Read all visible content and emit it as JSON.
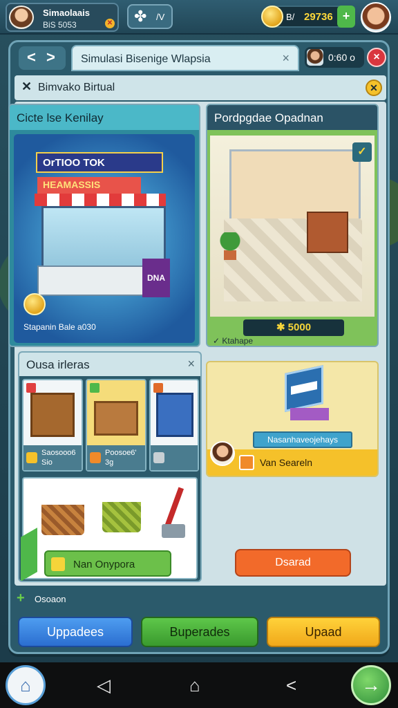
{
  "player": {
    "name": "Simaolaais",
    "sub": "BiS 5053",
    "badge": "✕"
  },
  "puzzle": {
    "icon": "puzzle-icon",
    "label": "/V"
  },
  "currency": {
    "prefix": "B/",
    "value": "29736",
    "plus": "+"
  },
  "window": {
    "back": "<",
    "forward": ">",
    "title": "Simulasi Bisenige Wlapsia",
    "title_close": "×",
    "timer": "0:60 o",
    "close": "×"
  },
  "section": {
    "title": "Bimvako Birtual",
    "icon_x": "✕",
    "help": "✕"
  },
  "store_card": {
    "title": "Cicte lse Kenilay",
    "sign1": "OrTIOO TOK",
    "sign2": "HEAMASSIS",
    "block": "DNA",
    "caption": "Stapanin Bale a030"
  },
  "market_card": {
    "title": "Pordpgdae Opadnan",
    "check": "✓",
    "price": "✱ 5000",
    "caption": "✓ Ktahape"
  },
  "ideas": {
    "title": "Ousa irleras",
    "close": "×",
    "items": [
      {
        "line1": "Saosooo6",
        "line2": "Sio",
        "tag_color": "#e04040"
      },
      {
        "line1": "Poosoe6'",
        "line2": "3g",
        "tag_color": "#4fb84a"
      },
      {
        "line1": "",
        "line2": "",
        "tag_color": "#e06a2a"
      }
    ],
    "button": "Nan Onypora"
  },
  "promo": {
    "label": "Nasanhaveojehays",
    "footer": "Van Seareln"
  },
  "orange_button": "Dsarad",
  "small_label": {
    "icon": "+",
    "text": "Osoaon"
  },
  "bottom_buttons": {
    "blue": "Uppadees",
    "green": "Buperades",
    "yellow": "Upaad"
  },
  "android": {
    "home": "⌂",
    "back": "◁",
    "home2": "⌂",
    "recent": "<",
    "next": "→"
  },
  "colors": {
    "accent": "#6fa3b6",
    "blue": "#2b6ed0",
    "green": "#3a9a2e",
    "yellow": "#f0a81a",
    "orange": "#f26a2a"
  }
}
